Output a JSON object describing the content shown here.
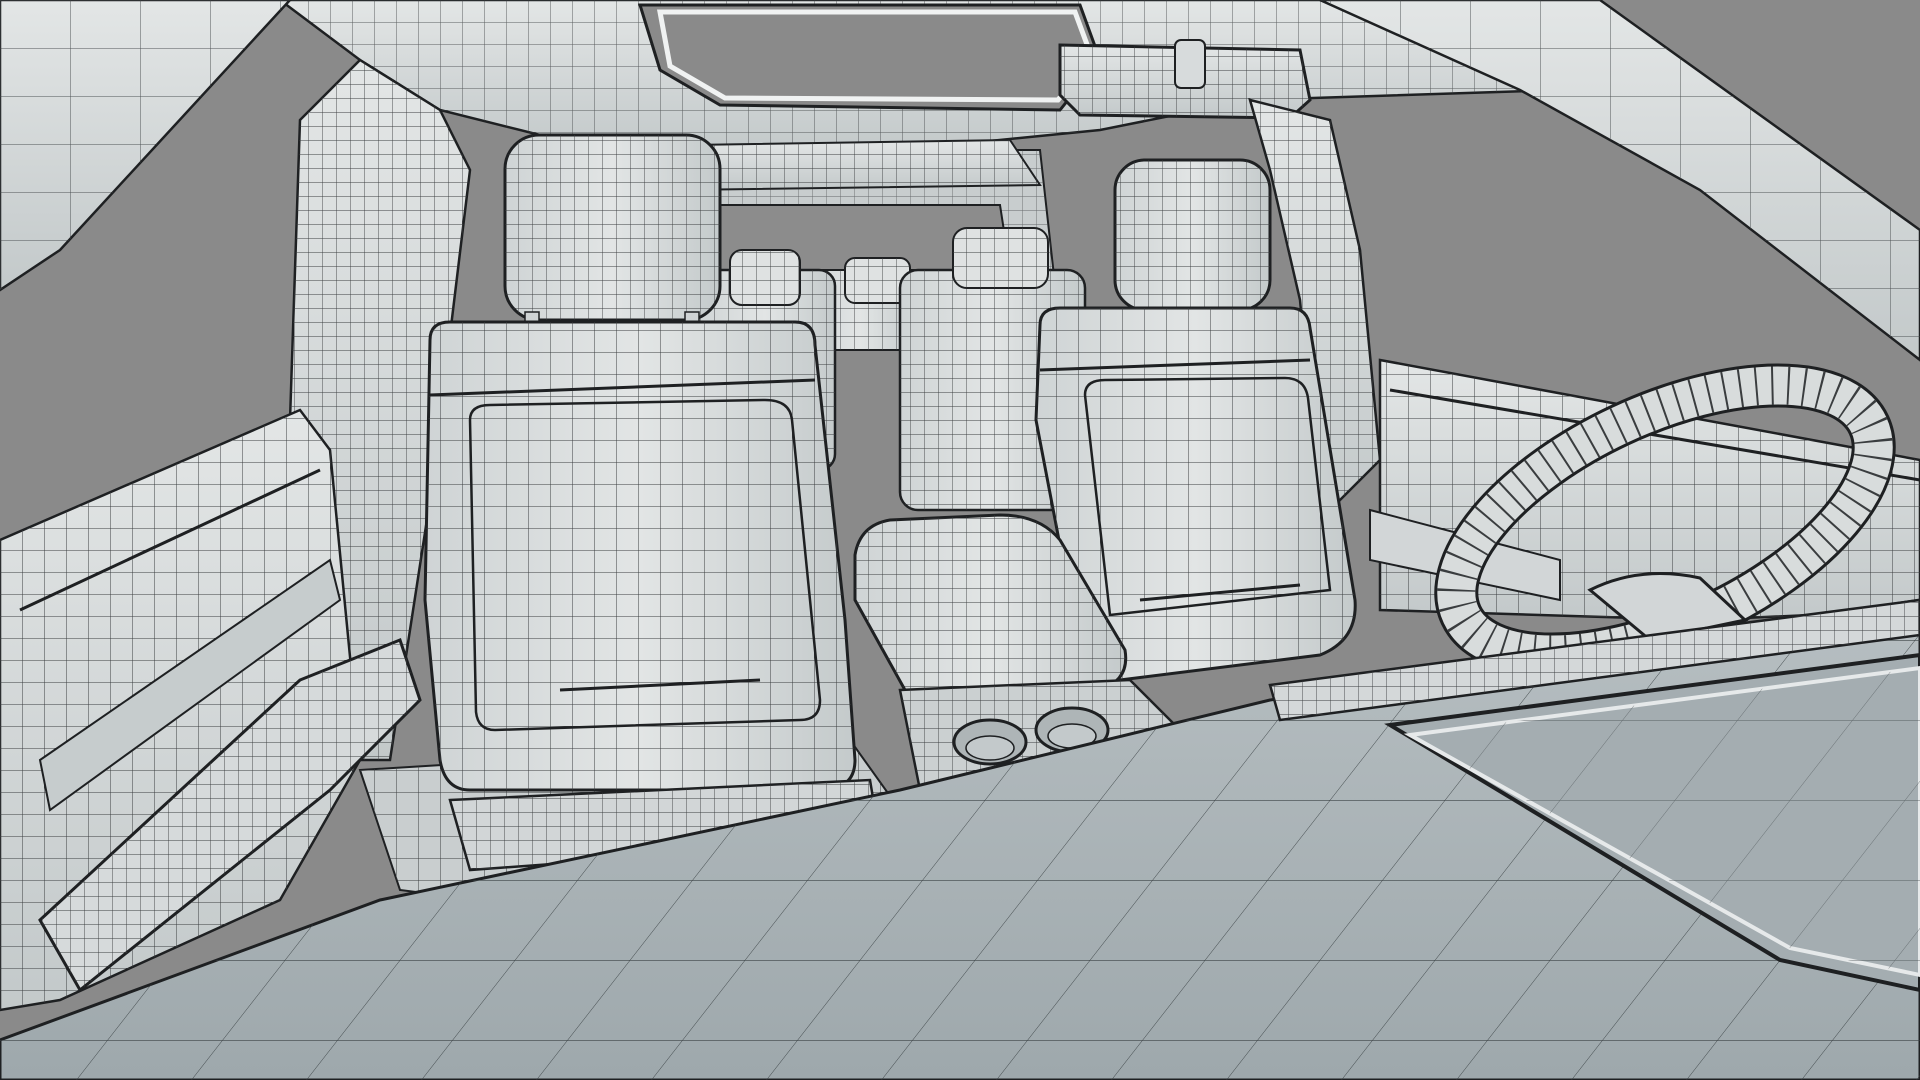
{
  "viewport": {
    "background_color": "#8a8a8a",
    "surface_color": "#d9dcdc",
    "surface_shadow_color": "#b9bfc1",
    "dashboard_color": "#a9b2b6",
    "wire_color": "#3a3d3f",
    "edge_color": "#1e2022"
  },
  "scene": {
    "components": [
      "headliner",
      "sunroof-opening",
      "rearview-mirror",
      "roof-pillar-left",
      "roof-pillar-right",
      "b-pillar-left",
      "b-pillar-right",
      "left-door-panel",
      "right-door-panel",
      "front-passenger-seat",
      "front-driver-seat",
      "rear-seat-left",
      "rear-seat-right",
      "third-row-seat",
      "center-console",
      "cup-holders",
      "steering-wheel",
      "dashboard",
      "dashboard-tray"
    ]
  }
}
